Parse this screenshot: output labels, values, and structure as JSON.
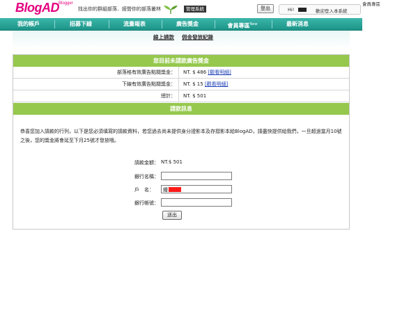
{
  "header": {
    "logo": "BlogAD",
    "logo_sub": "Blogger",
    "slogan": "找出你的群組部落．經營你的部落叢林",
    "mgmt_badge": "管理系統",
    "logout": "登出",
    "hi": "Hi!",
    "welcome": "歡迎登入本系統",
    "corner": "會員專區"
  },
  "nav": {
    "items": [
      "我的帳戶",
      "招募下線",
      "流量報表",
      "廣告獎金",
      "會員專區",
      "最新消息"
    ],
    "new_badge": "New"
  },
  "subtabs": [
    "線上請款",
    "佣金發放紀錄"
  ],
  "summary": {
    "title": "您目前未請款廣告獎金",
    "rows": [
      {
        "label": "部落格有效廣告點閱獎金：",
        "value": "NT. $ 486",
        "link": "[觀看明細]"
      },
      {
        "label": "下線有效廣告點閱獎金：",
        "value": "NT. $ 15",
        "link": "[觀看明細]"
      },
      {
        "label": "總計：",
        "value": "NT. $ 501",
        "link": ""
      }
    ]
  },
  "request": {
    "title": "請款訊息",
    "notice": "恭喜您加入請款的行列，以下是您必須填寫的請款資料，若您過去尚未提供身分證影本及存摺影本給BlogAD，請盡快提供給我們，一旦超過當月10號之後，您的獎金將會延至下月25號才發放哦。",
    "amount_label": "請款金額：",
    "amount_value": "NT.$ 501",
    "bank_label": "銀行名稱：",
    "name_label": "戶　名：",
    "name_prefix": "鍾",
    "account_label": "銀行帳號：",
    "submit": "送出"
  },
  "colors": {
    "nav": "#1fa094",
    "green_bar": "#95c84d",
    "logo": "#e4007f",
    "link": "#2345b8"
  }
}
